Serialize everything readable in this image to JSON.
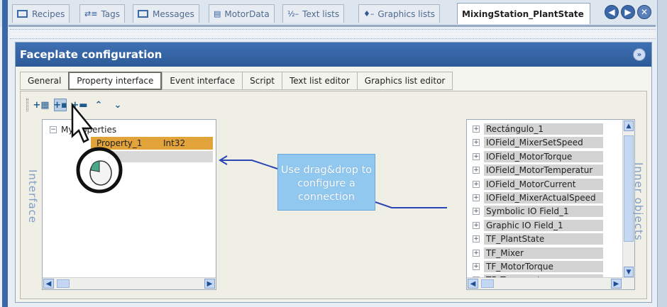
{
  "editor_tabs": [
    {
      "label": "Recipes"
    },
    {
      "label": "Tags"
    },
    {
      "label": "Messages"
    },
    {
      "label": "MotorData"
    },
    {
      "label": "Text lists"
    },
    {
      "label": "Graphics lists"
    }
  ],
  "active_editor_tab": "MixingStation_PlantState",
  "panel": {
    "title": "Faceplate configuration",
    "tabs": [
      "General",
      "Property interface",
      "Event interface",
      "Script",
      "Text list editor",
      "Graphics list editor"
    ],
    "active_tab": "Property interface"
  },
  "interface": {
    "side_label": "Interface",
    "root": "MyProperties",
    "property": {
      "name": "Property_1",
      "type": "Int32"
    }
  },
  "inner_objects": {
    "side_label": "Inner objects",
    "items": [
      "Rectángulo_1",
      "IOField_MixerSetSpeed",
      "IOField_MotorTorque",
      "IOField_MotorTemperatur",
      "IOField_MotorCurrent",
      "IOField_MixerActualSpeed",
      "Symbolic IO Field_1",
      "Graphic IO Field_1",
      "TF_PlantState",
      "TF_Mixer",
      "TF_MotorTorque",
      "TF_Temperature"
    ]
  },
  "callout": {
    "text": "Use drag&drop to configure a connection"
  },
  "colors": {
    "accent": "#2f5a98",
    "selection": "#e2a33a",
    "callout": "#90c8f0"
  }
}
